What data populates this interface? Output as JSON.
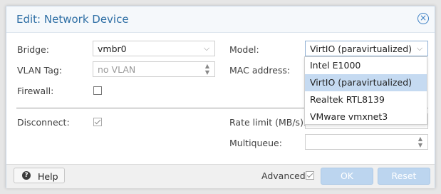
{
  "dialog": {
    "title": "Edit: Network Device",
    "close_icon": "close-circle-icon"
  },
  "form": {
    "bridge": {
      "label": "Bridge:",
      "value": "vmbr0"
    },
    "vlan": {
      "label": "VLAN Tag:",
      "placeholder": "no VLAN"
    },
    "firewall": {
      "label": "Firewall:",
      "checked": false
    },
    "model": {
      "label": "Model:",
      "value": "VirtIO (paravirtualized)"
    },
    "mac": {
      "label": "MAC address:"
    },
    "disconnect": {
      "label": "Disconnect:",
      "checked": true
    },
    "rate_limit": {
      "label": "Rate limit (MB/s):"
    },
    "multiqueue": {
      "label": "Multiqueue:"
    }
  },
  "model_options": [
    {
      "label": "Intel E1000",
      "selected": false
    },
    {
      "label": "VirtIO (paravirtualized)",
      "selected": true
    },
    {
      "label": "Realtek RTL8139",
      "selected": false
    },
    {
      "label": "VMware vmxnet3",
      "selected": false
    }
  ],
  "footer": {
    "help_label": "Help",
    "advanced_label": "Advanced",
    "advanced_checked": true,
    "ok_label": "OK",
    "reset_label": "Reset"
  },
  "colors": {
    "title": "#2f6fa5",
    "button_disabled": "#bcd5ef",
    "selected_option": "#c5daf1"
  }
}
